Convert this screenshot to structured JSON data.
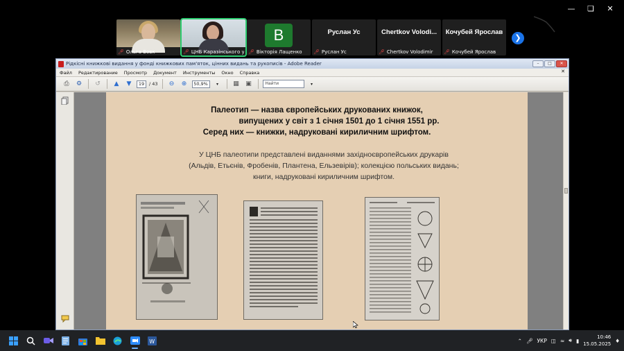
{
  "meeting": {
    "participants": [
      {
        "name": "Ольга Вовк",
        "kind": "video-1"
      },
      {
        "name": "ЦНБ Каразінського уніве...",
        "kind": "video-2",
        "active": true
      },
      {
        "name": "Вікторія Лащенко",
        "kind": "letter",
        "letter": "В"
      },
      {
        "name": "Руслан Ус",
        "kind": "name",
        "big": "Руслан Ус"
      },
      {
        "name": "Chertkov Volodimir",
        "kind": "name",
        "big": "Chertkov Volodi..."
      },
      {
        "name": "Кочубей Ярослав",
        "kind": "name",
        "big": "Кочубей Ярослав"
      }
    ],
    "mic_muted_icon": "mic-off-icon",
    "accent": "#2ecc71"
  },
  "reader": {
    "title": "Рідкісні книжкові видання у фонді книжкових пам'яток, цінних видань та рукописів - Adobe Reader",
    "menu": [
      "Файл",
      "Редактирование",
      "Просмотр",
      "Документ",
      "Инструменты",
      "Окно",
      "Справка"
    ],
    "page_current": "19",
    "page_total": "/ 43",
    "zoom": "50,9%",
    "find_placeholder": "Найти"
  },
  "slide": {
    "heading": [
      "Палеотип — назва європейських друкованих книжок,",
      "випущених у світ з 1 січня 1501 до 1 січня 1551 рр.",
      "Серед них — книжки, надруковані кириличним шрифтом."
    ],
    "body": [
      "У ЦНБ палеотипи представлені виданнями західноєвропейських друкарів",
      "(Альдів, Етьєнів, Фробенів, Плантена, Ельзевірів); колекцією польських видань;",
      "книги, надруковані кириличним шрифтом."
    ],
    "background": "#e5cfb3"
  },
  "taskbar": {
    "language": "УКР",
    "time": "10:46",
    "date": "15.05.2025"
  }
}
